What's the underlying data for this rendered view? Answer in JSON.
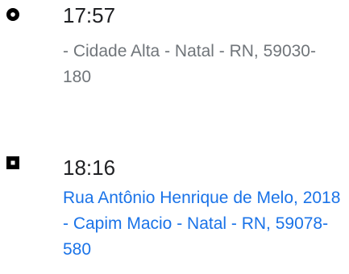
{
  "route": {
    "origin": {
      "time": "17:57",
      "address": "- Cidade Alta - Natal - RN, 59030-180",
      "marker_icon": "circle-marker-icon"
    },
    "destination": {
      "time": "18:16",
      "address": "Rua Antônio Henrique de Melo, 2018 - Capim Macio - Natal - RN, 59078-580",
      "marker_icon": "square-marker-icon"
    }
  },
  "colors": {
    "time_text": "#202124",
    "origin_address": "#70757a",
    "destination_link": "#1a73e8",
    "marker": "#000000"
  }
}
